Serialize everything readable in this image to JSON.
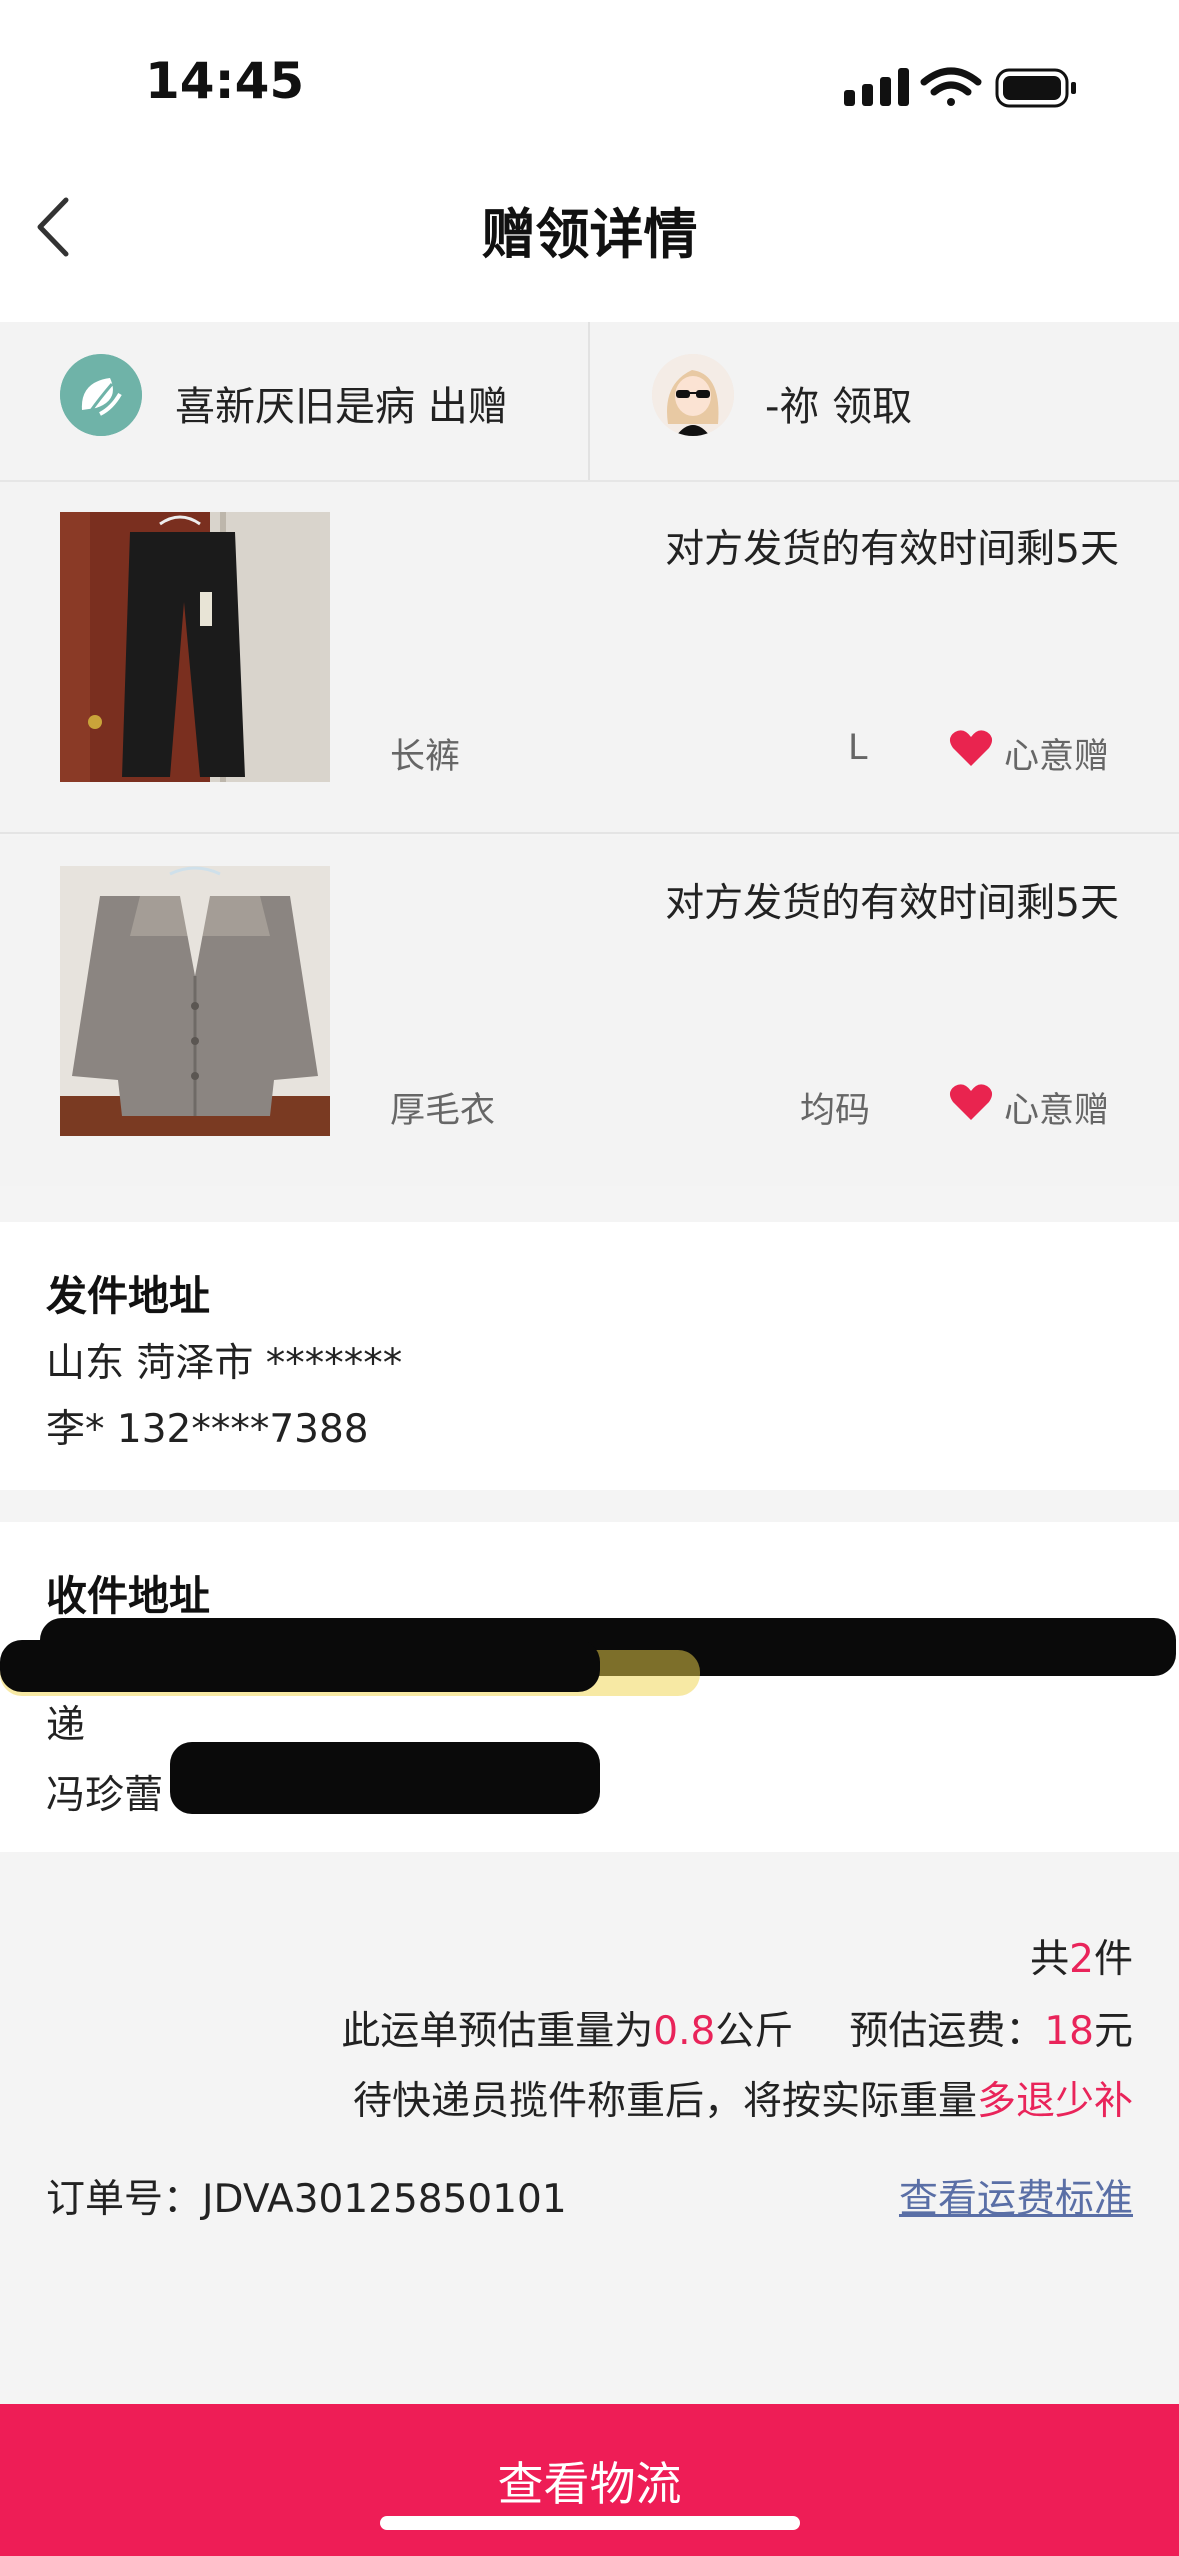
{
  "status_bar": {
    "time": "14:45"
  },
  "header": {
    "title": "赠领详情",
    "back_icon": "chevron-left-icon"
  },
  "parties": {
    "giver": {
      "name": "喜新厌旧是病 出赠",
      "avatar": "leaf-logo-avatar"
    },
    "receiver": {
      "name": "-祢 领取",
      "avatar": "girl-sunglasses-avatar"
    }
  },
  "items": [
    {
      "validity": "对方发货的有效时间剩5天",
      "name": "长裤",
      "size": "L",
      "gift_label": "心意赠",
      "gift_icon": "heart-icon"
    },
    {
      "validity": "对方发货的有效时间剩5天",
      "name": "厚毛衣",
      "size": "均码",
      "gift_label": "心意赠",
      "gift_icon": "heart-icon"
    }
  ],
  "sender_address": {
    "title": "发件地址",
    "line1": "山东 菏泽市 *******",
    "line2": "李* 132****7388"
  },
  "receiver_address": {
    "title": "收件地址",
    "line2": "递",
    "line3": "冯珍蕾 19101"
  },
  "shipping": {
    "count_prefix": "共",
    "count": "2",
    "count_suffix": "件",
    "weight_prefix": "此运单预估重量为",
    "weight": "0.8",
    "weight_unit": "公斤",
    "fee_prefix": "预估运费：",
    "fee": "18",
    "fee_unit": "元",
    "note_prefix": "待快递员揽件称重后，将按实际重量",
    "note_highlight": "多退少补"
  },
  "order": {
    "label": "订单号：",
    "number": "JDVA30125850101",
    "fee_standard_link": "查看运费标准"
  },
  "cta": {
    "label": "查看物流"
  },
  "colors": {
    "accent": "#ee1d56",
    "highlight": "#e9245a",
    "link": "#5a6fa6",
    "heart": "#e9244f"
  }
}
